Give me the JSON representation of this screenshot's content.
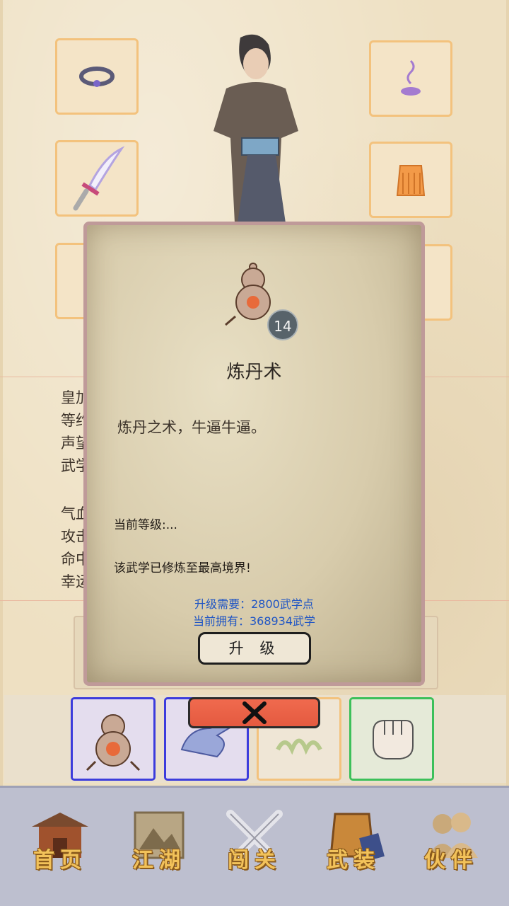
{
  "stats_partial": {
    "line1": "皇加",
    "line2": "等约",
    "line3": "声望",
    "line4": "武学",
    "line5": "气血",
    "line6": "攻击",
    "line7": "命中",
    "line8": "幸运"
  },
  "modal": {
    "skill_icon": "gourd-alchemy-icon",
    "level_badge": "14",
    "title": "炼丹术",
    "description": "炼丹之术，牛逼牛逼。",
    "current_level_label": "当前等级:...",
    "max_text": "该武学已修炼至最高境界!",
    "upgrade_need": "升级需要：2800武学点",
    "current_have": "当前拥有：368934武学",
    "upgrade_button": "升 级",
    "close_icon": "x-close-icon"
  },
  "equipment": {
    "slots": [
      "ring-icon",
      "incense-icon",
      "sword-icon",
      "armor-icon",
      "slot-left-3",
      "slot-right-3"
    ]
  },
  "skills": [
    "gourd-alchemy-icon",
    "palm-icon",
    "grass-icon",
    "fist-icon"
  ],
  "nav": {
    "items": [
      {
        "label": "首页",
        "icon": "pavilion-icon"
      },
      {
        "label": "江湖",
        "icon": "scroll-mountain-icon"
      },
      {
        "label": "闯关",
        "icon": "crossed-swords-icon"
      },
      {
        "label": "武装",
        "icon": "armor-book-icon"
      },
      {
        "label": "伙伴",
        "icon": "partners-icon"
      }
    ]
  },
  "colors": {
    "skill_border_blue": "#3c3cdc",
    "skill_border_orange": "#f3c27d",
    "skill_border_green": "#3cc05a",
    "req_text": "#1f55c4",
    "nav_label": "#f2c25a"
  }
}
